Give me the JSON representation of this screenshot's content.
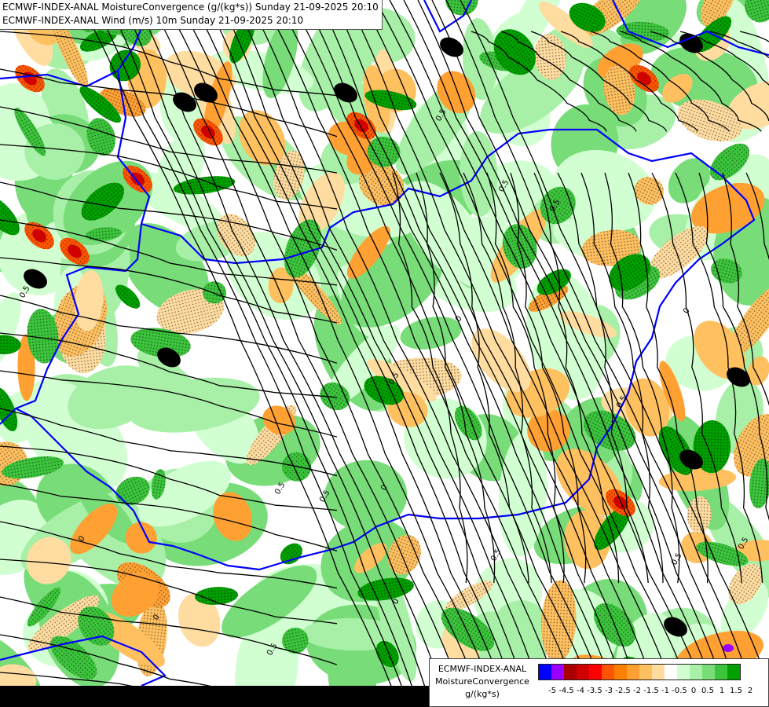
{
  "header": {
    "line1": "ECMWF-INDEX-ANAL MoistureConvergence (g/(kg*s)) Sunday 21-09-2025 20:10",
    "line2": "ECMWF-INDEX-ANAL Wind (m/s) 10m Sunday 21-09-2025 20:10"
  },
  "legend": {
    "title_lines": [
      "ECMWF-INDEX-ANAL",
      "MoistureConvergence",
      "g/(kg*s)"
    ],
    "colors": [
      "#0000ff",
      "#9900ff",
      "#aa0000",
      "#d00000",
      "#ff0000",
      "#ff5500",
      "#ff8000",
      "#ffa033",
      "#ffc060",
      "#ffdca0",
      "#ffffff",
      "#d2ffd2",
      "#a8f0a8",
      "#78dc78",
      "#3cc43c",
      "#00a000"
    ],
    "ticks": [
      "-5",
      "-4.5",
      "-4",
      "-3.5",
      "-3",
      "-2.5",
      "-2",
      "-1.5",
      "-1",
      "-0.5",
      "0",
      "0.5",
      "1",
      "1.5",
      "2"
    ]
  },
  "map": {
    "contour_labels": [
      "0.5",
      "0.5",
      "0.5",
      "0",
      "0.5",
      "0.5",
      "0",
      "0.5",
      "0.5",
      "0",
      "0.5",
      "0.5",
      "0.5",
      "0",
      "0.5",
      "0",
      "0.5",
      "0"
    ]
  },
  "colors": {
    "border": "#0000ff",
    "streamline": "#000000",
    "background": "#ffffff"
  }
}
